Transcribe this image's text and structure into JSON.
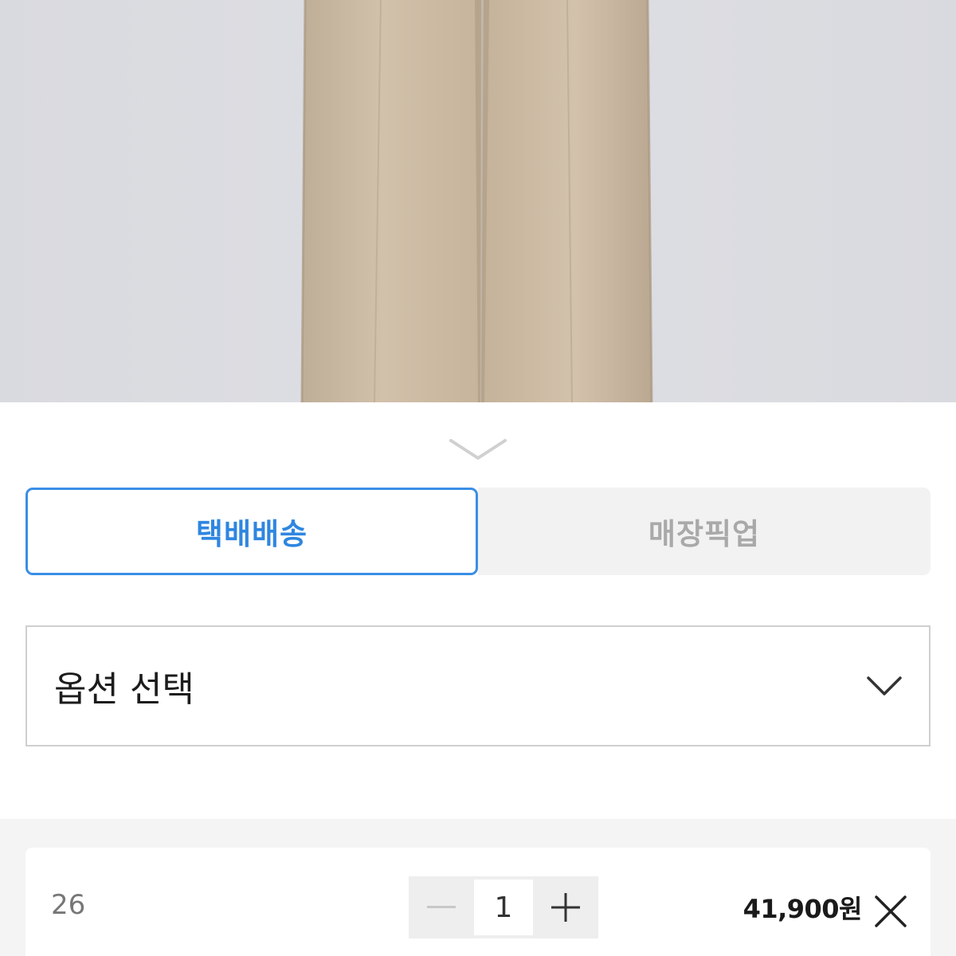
{
  "delivery_tabs": {
    "parcel_label": "택배배송",
    "store_pickup_label": "매장픽업"
  },
  "option_select": {
    "label": "옵션 선택"
  },
  "selected_item": {
    "size": "26",
    "quantity": "1",
    "price": "41,900원"
  },
  "icons": {
    "collapse": "chevron-down-icon",
    "select": "chevron-down-icon",
    "decrement": "minus-icon",
    "increment": "plus-icon",
    "remove": "close-icon"
  },
  "colors": {
    "accent": "#2f86e0",
    "inactive_text": "#a9a9a9",
    "panel_bg": "#f4f4f4"
  }
}
